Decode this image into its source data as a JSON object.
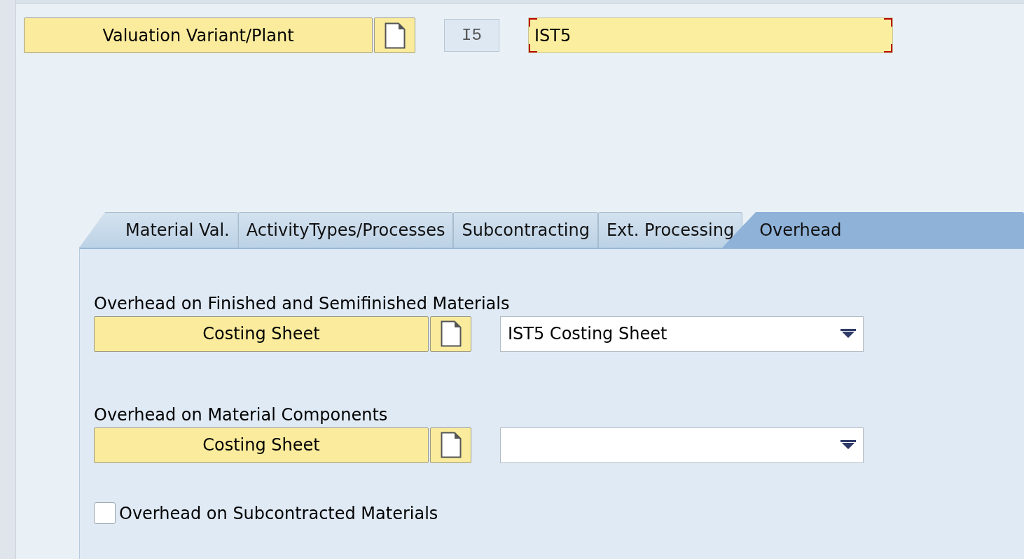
{
  "header": {
    "button": "Valuation Variant/Plant",
    "code": "I5",
    "value": "IST5"
  },
  "tabs": [
    {
      "label": "Material Val.",
      "selected": false
    },
    {
      "label": "ActivityTypes/Processes",
      "selected": false
    },
    {
      "label": "Subcontracting",
      "selected": false
    },
    {
      "label": "Ext. Processing",
      "selected": false
    },
    {
      "label": "Overhead",
      "selected": true
    }
  ],
  "sections": [
    {
      "kind": "select-group",
      "title": "Overhead on Finished and Semifinished Materials",
      "button": "Costing Sheet",
      "value": "IST5 Costing Sheet"
    },
    {
      "kind": "select-group",
      "title": "Overhead on Material Components",
      "button": "Costing Sheet"
    }
  ],
  "checkbox": {
    "label": "Overhead on Subcontracted Materials",
    "checked": false
  }
}
